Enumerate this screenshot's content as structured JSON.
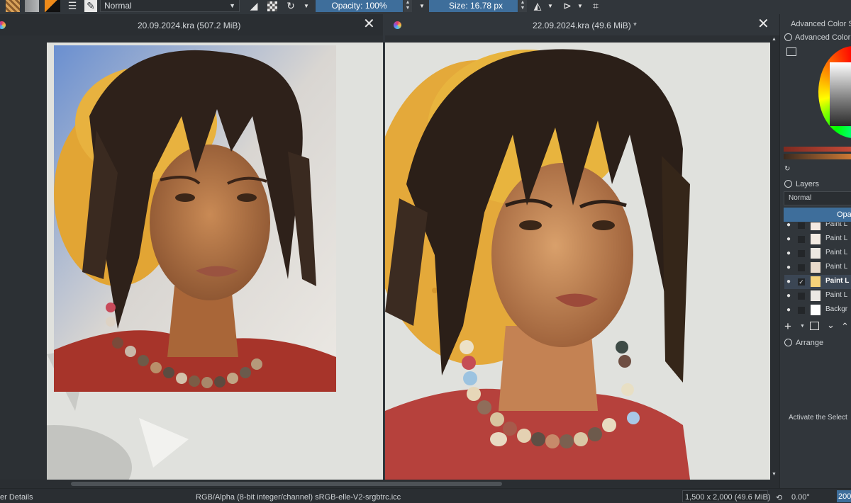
{
  "toolbar": {
    "blend_mode": "Normal",
    "opacity_label": "Opacity: 100%",
    "size_label": "Size: 16.78 px",
    "icons": [
      "pattern-swatch-icon",
      "gradient-swatch-icon",
      "color-swatch-icon",
      "brush-presets-icon",
      "brush-editor-icon",
      "eraser-icon",
      "alpha-lock-icon",
      "reload-preset-icon",
      "mirror-horizontal-icon",
      "mirror-vertical-icon",
      "crop-icon"
    ]
  },
  "tabs": [
    {
      "title": "20.09.2024.kra (507.2 MiB)"
    },
    {
      "title": "22.09.2024.kra (49.6 MiB) *"
    }
  ],
  "colors": {
    "accent": "#3e6e9b",
    "panel": "#31363b",
    "dark": "#2a2e32",
    "canvas": "#e0e1dd",
    "hat_yellow": "#e4a93a",
    "shirt_red": "#b6413c"
  },
  "dockers": {
    "advanced_color_title": "Advanced Color Se",
    "advanced_color_subtitle": "Advanced Color S",
    "layers_title": "Layers",
    "layers_blend": "Normal",
    "layers_opacity": "Opa",
    "arrange_title": "Arrange",
    "select_hint": "Activate the Select",
    "layers": [
      {
        "name": "Paint L",
        "visible": true,
        "checked": false,
        "active": false
      },
      {
        "name": "Paint L",
        "visible": true,
        "checked": false,
        "active": false
      },
      {
        "name": "Paint L",
        "visible": true,
        "checked": false,
        "active": false
      },
      {
        "name": "Paint L",
        "visible": true,
        "checked": false,
        "active": false
      },
      {
        "name": "Paint L",
        "visible": true,
        "checked": true,
        "active": true
      },
      {
        "name": "Paint L",
        "visible": true,
        "checked": false,
        "active": false
      },
      {
        "name": "Backgr",
        "visible": true,
        "checked": false,
        "active": false
      }
    ]
  },
  "status": {
    "left": "er Details",
    "color_space": "RGB/Alpha (8-bit integer/channel)  sRGB-elle-V2-srgbtrc.icc",
    "dimensions": "1,500 x 2,000 (49.6 MiB)",
    "rotation": "0.00°",
    "zoom": "200"
  }
}
